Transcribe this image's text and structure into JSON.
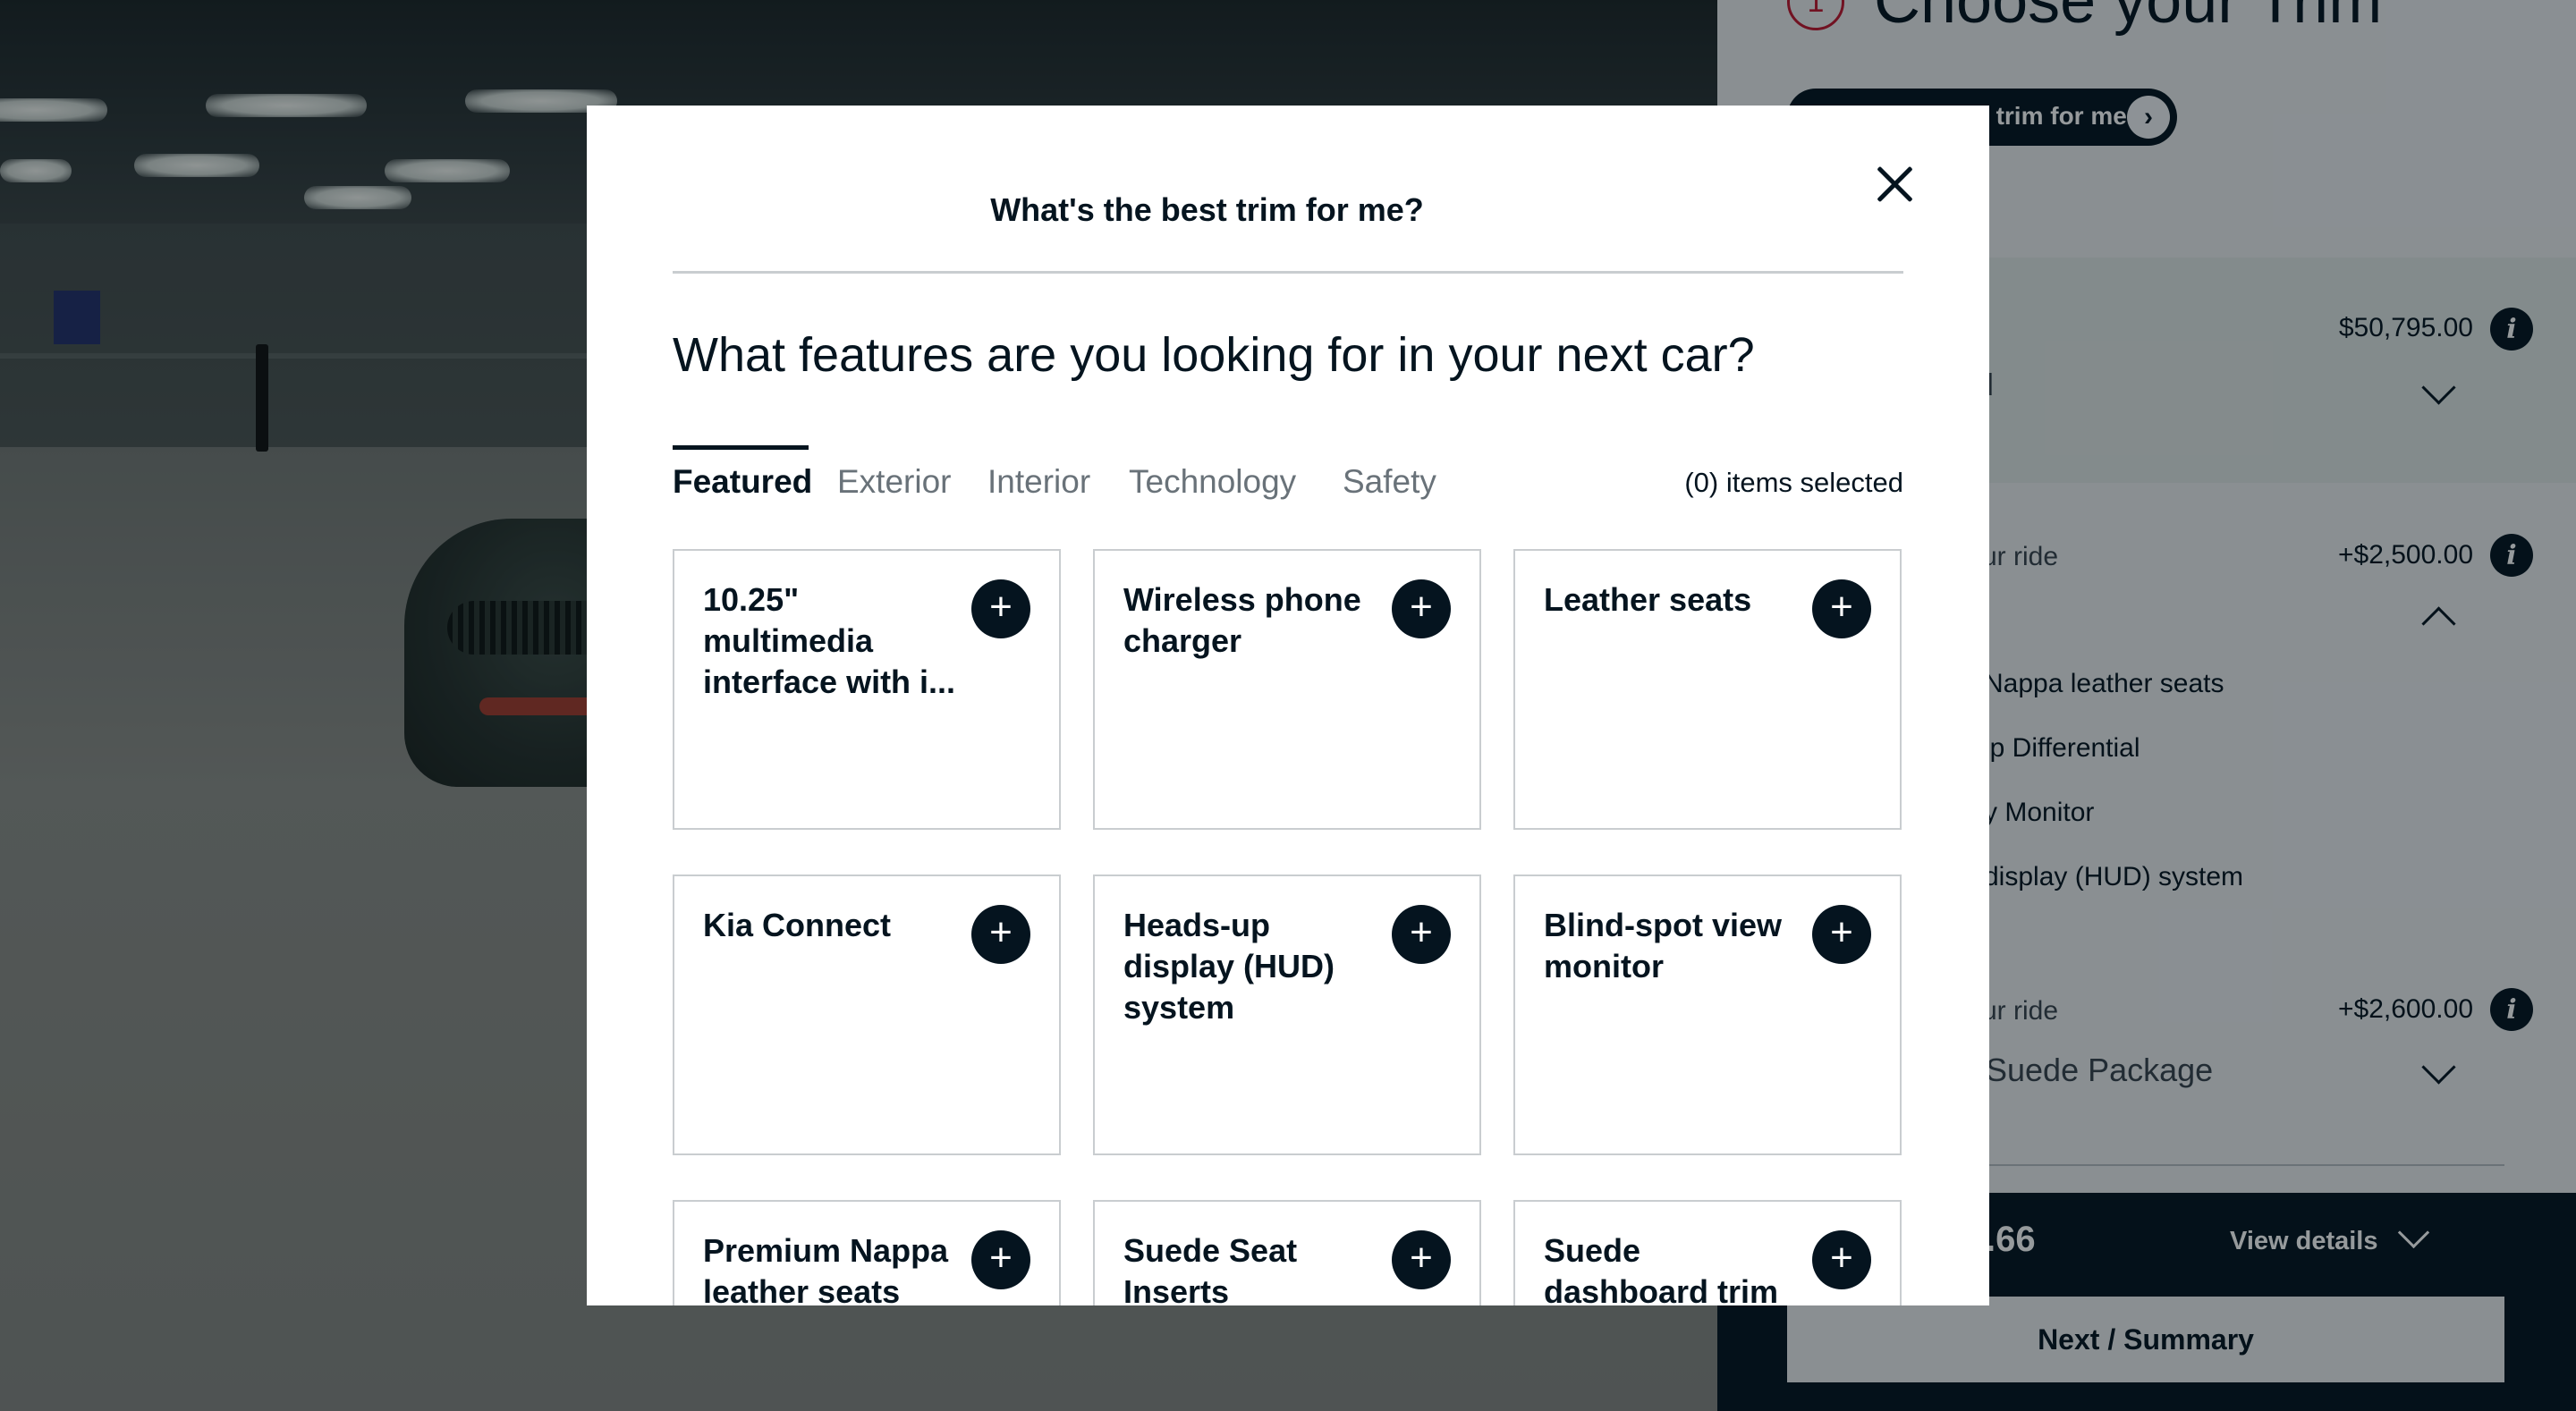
{
  "panel": {
    "heading": "Choose your Trim",
    "step_number": "1",
    "trim_button_label": "What's the best trim for me?",
    "trim_button_arrow": "›",
    "base_price": "$50,795.00",
    "base_trim_name_partial": "d",
    "package1_label_partial": "ur ride",
    "package1_price": "+$2,500.00",
    "package1_features": [
      "Nappa leather seats",
      "ip Differential",
      "y Monitor",
      "display (HUD) system"
    ],
    "package2_label_partial": "ur ride",
    "package2_price": "+$2,600.00",
    "package2_name_partial": "Suede Package",
    "info_glyph": "i",
    "footer_price_partial": ".66",
    "view_details_label": "View details",
    "next_button_label": "Next / Summary"
  },
  "modal": {
    "title": "What's the best trim for me?",
    "question": "What features are you looking for in your next car?",
    "tabs": [
      "Featured",
      "Exterior",
      "Interior",
      "Technology",
      "Safety"
    ],
    "active_tab": "Featured",
    "items_selected_text": "(0) items selected",
    "plus_glyph": "+",
    "features": [
      "10.25\" multimedia interface with i...",
      "Wireless phone charger",
      "Leather seats",
      "Kia Connect",
      "Heads-up display (HUD) system",
      "Blind-spot view monitor",
      "Premium Nappa leather seats",
      "Suede Seat Inserts",
      "Suede dashboard trim"
    ]
  },
  "colors": {
    "primary_dark": "#05141f",
    "accent_red": "#c0162d",
    "card_border": "#c9cdd0"
  },
  "icons": {
    "close": "close-icon",
    "add": "plus-icon",
    "info": "info-icon",
    "chevron": "chevron-down-icon"
  }
}
